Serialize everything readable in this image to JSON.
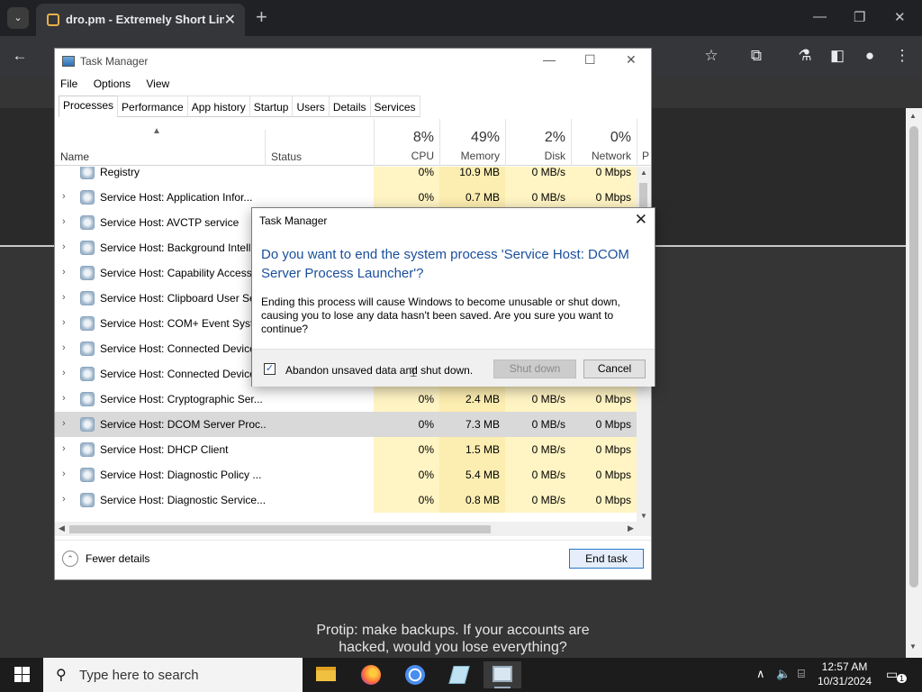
{
  "browser": {
    "tab_title": "dro.pm - Extremely Short Links",
    "tab_close": "✕",
    "new_tab": "+",
    "window_controls": [
      "—",
      "❐",
      "✕"
    ]
  },
  "webpage": {
    "protip": "Protip: make backups. If your accounts are hacked, would you lose everything?"
  },
  "task_manager": {
    "title": "Task Manager",
    "window_controls": [
      "—",
      "☐",
      "✕"
    ],
    "menu": [
      "File",
      "Options",
      "View"
    ],
    "tabs": [
      "Processes",
      "Performance",
      "App history",
      "Startup",
      "Users",
      "Details",
      "Services"
    ],
    "columns": {
      "name": "Name",
      "status": "Status",
      "cpu": {
        "pct": "8%",
        "label": "CPU"
      },
      "memory": {
        "pct": "49%",
        "label": "Memory"
      },
      "disk": {
        "pct": "2%",
        "label": "Disk"
      },
      "network": {
        "pct": "0%",
        "label": "Network"
      },
      "extra": "P"
    },
    "rows": [
      {
        "name": "Registry",
        "cpu": "0%",
        "memory": "10.9 MB",
        "disk": "0 MB/s",
        "network": "0 Mbps"
      },
      {
        "name": "Service Host: Application Infor...",
        "cpu": "0%",
        "memory": "0.7 MB",
        "disk": "0 MB/s",
        "network": "0 Mbps"
      },
      {
        "name": "Service Host: AVCTP service",
        "cpu": "",
        "memory": "",
        "disk": "",
        "network": ""
      },
      {
        "name": "Service Host: Background Intelli...",
        "cpu": "",
        "memory": "",
        "disk": "",
        "network": ""
      },
      {
        "name": "Service Host: Capability Access ...",
        "cpu": "",
        "memory": "",
        "disk": "",
        "network": ""
      },
      {
        "name": "Service Host: Clipboard User Ser...",
        "cpu": "",
        "memory": "",
        "disk": "",
        "network": ""
      },
      {
        "name": "Service Host: COM+ Event Syste...",
        "cpu": "",
        "memory": "",
        "disk": "",
        "network": ""
      },
      {
        "name": "Service Host: Connected Device...",
        "cpu": "",
        "memory": "",
        "disk": "",
        "network": ""
      },
      {
        "name": "Service Host: Connected Device...",
        "cpu": "",
        "memory": "",
        "disk": "",
        "network": ""
      },
      {
        "name": "Service Host: Cryptographic Ser...",
        "cpu": "0%",
        "memory": "2.4 MB",
        "disk": "0 MB/s",
        "network": "0 Mbps"
      },
      {
        "name": "Service Host: DCOM Server Proc...",
        "cpu": "0%",
        "memory": "7.3 MB",
        "disk": "0 MB/s",
        "network": "0 Mbps"
      },
      {
        "name": "Service Host: DHCP Client",
        "cpu": "0%",
        "memory": "1.5 MB",
        "disk": "0 MB/s",
        "network": "0 Mbps"
      },
      {
        "name": "Service Host: Diagnostic Policy ...",
        "cpu": "0%",
        "memory": "5.4 MB",
        "disk": "0 MB/s",
        "network": "0 Mbps"
      },
      {
        "name": "Service Host: Diagnostic Service...",
        "cpu": "0%",
        "memory": "0.8 MB",
        "disk": "0 MB/s",
        "network": "0 Mbps"
      }
    ],
    "fewer_details": "Fewer details",
    "end_task": "End task"
  },
  "dialog": {
    "title": "Task Manager",
    "close": "✕",
    "question": "Do you want to end the system process 'Service Host: DCOM Server Process Launcher'?",
    "body": "Ending this process will cause Windows to become unusable or shut down, causing you to lose any data hasn't been saved. Are you sure you want to continue?",
    "checkbox_label": "Abandon unsaved data and shut down.",
    "checkbox_checked": true,
    "shutdown": "Shut down",
    "cancel": "Cancel"
  },
  "taskbar": {
    "search_placeholder": "Type here to search",
    "time": "12:57 AM",
    "date": "10/31/2024",
    "notification_count": "1"
  }
}
